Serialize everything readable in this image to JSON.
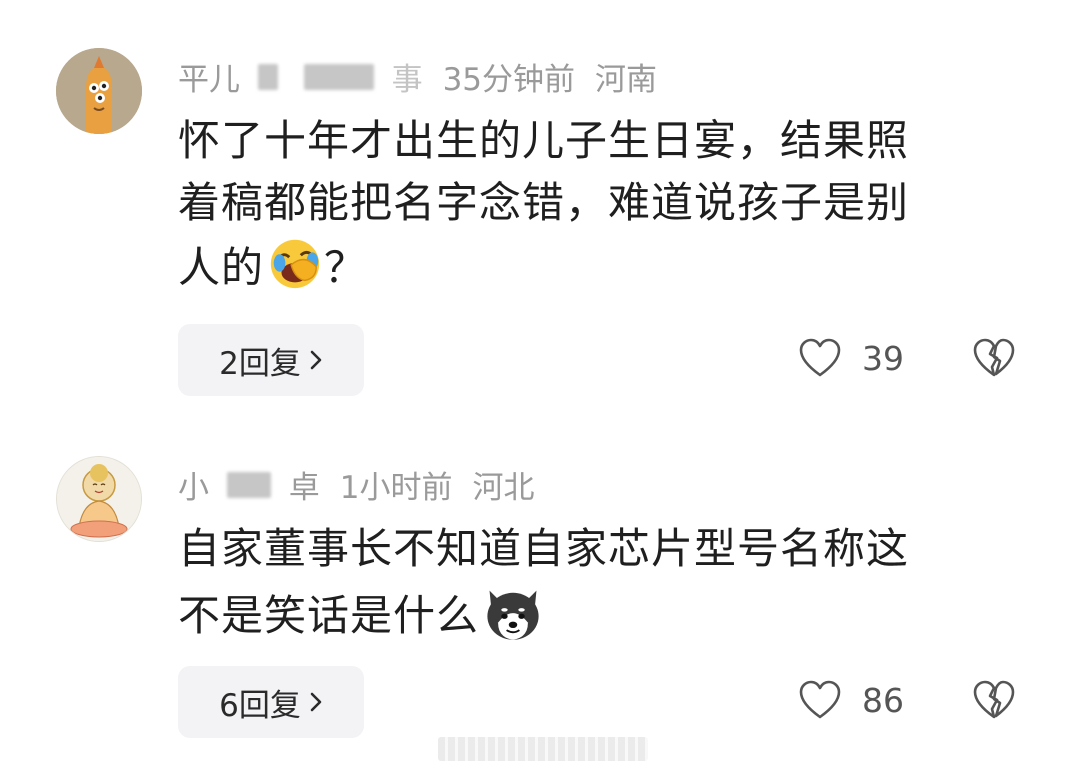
{
  "comments": [
    {
      "username_visible_start": "平儿",
      "username_visible_end": "事",
      "time": "35分钟前",
      "location": "河南",
      "text_lines": [
        "怀了十年才出生的儿子生日宴，结果照",
        "着稿都能把名字念错，难道说孩子是别",
        "人的"
      ],
      "text_after_emoji": "？",
      "emoji_icon": "face-hand-over-mouth-laughing-emoji",
      "reply_label": "2回复",
      "likes": "39"
    },
    {
      "username_visible_start": "小",
      "username_visible_end": "卓",
      "time": "1小时前",
      "location": "河北",
      "text_lines": [
        "自家董事长不知道自家芯片型号名称这",
        "不是笑话是什么"
      ],
      "emoji_icon": "husky-dog-emoji",
      "reply_label": "6回复",
      "likes": "86"
    }
  ],
  "colors": {
    "meta_text": "#9a9a9a",
    "body_text": "#1f1f1f",
    "reply_bg": "#f3f3f5",
    "icon_stroke": "#555555"
  }
}
